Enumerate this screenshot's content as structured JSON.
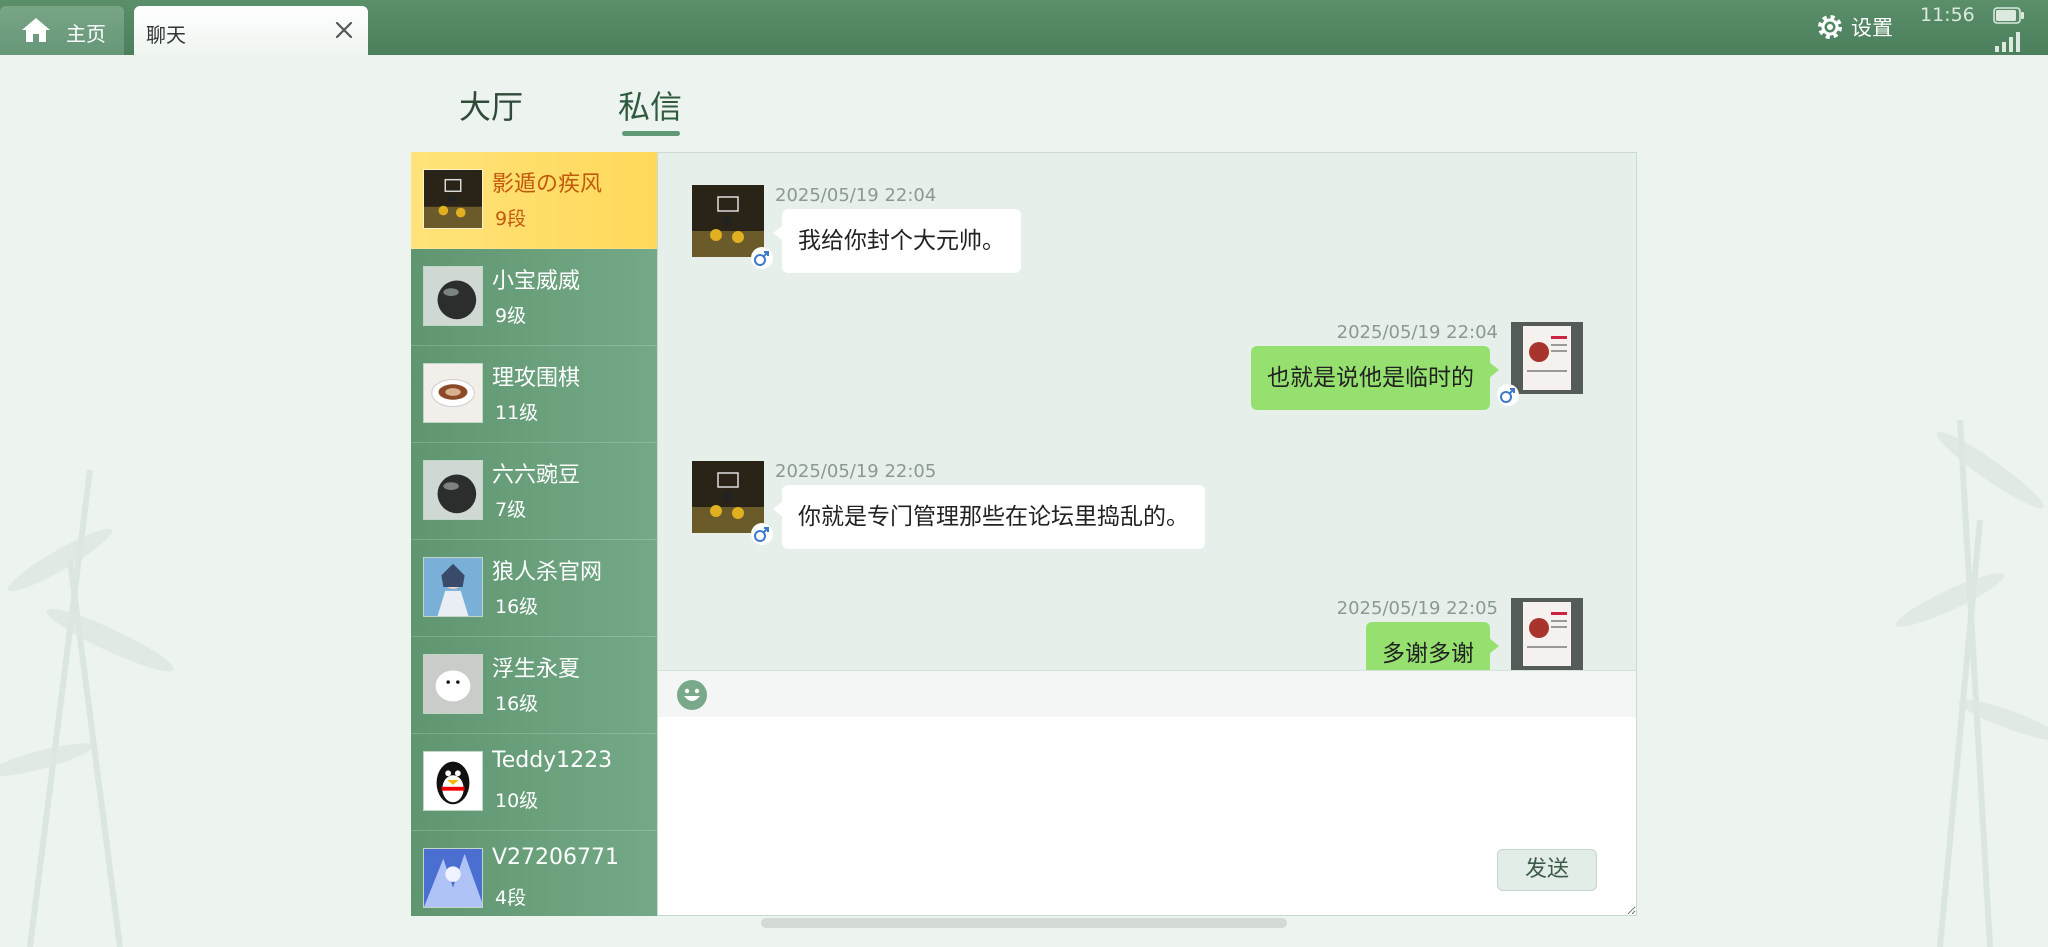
{
  "window": {
    "home_tab": "主页",
    "chat_tab": "聊天",
    "settings_label": "设置",
    "clock": "11:56"
  },
  "main_tabs": [
    {
      "label": "大厅",
      "active": false
    },
    {
      "label": "私信",
      "active": true
    }
  ],
  "contacts": [
    {
      "name": "影遁の疾风",
      "level": "9段",
      "active": true,
      "avatar": "basketball-photo"
    },
    {
      "name": "小宝威威",
      "level": "9级",
      "active": false,
      "avatar": "black-ball"
    },
    {
      "name": "理攻围棋",
      "level": "11级",
      "active": false,
      "avatar": "coffee-cup"
    },
    {
      "name": "六六豌豆",
      "level": "7级",
      "active": false,
      "avatar": "black-ball"
    },
    {
      "name": "狼人杀官网",
      "level": "16级",
      "active": false,
      "avatar": "anime-girl"
    },
    {
      "name": "浮生永夏",
      "level": "16级",
      "active": false,
      "avatar": "white-bird"
    },
    {
      "name": "Teddy1223",
      "level": "10级",
      "active": false,
      "avatar": "penguin"
    },
    {
      "name": "V27206771",
      "level": "4段",
      "active": false,
      "avatar": "anime-blue"
    }
  ],
  "messages": [
    {
      "side": "left",
      "time": "2025/05/19 22:04",
      "text": "我给你封个大元帅。",
      "avatar": "basketball-photo"
    },
    {
      "side": "right",
      "time": "2025/05/19 22:04",
      "text": "也就是说他是临时的",
      "avatar": "red-doc"
    },
    {
      "side": "left",
      "time": "2025/05/19 22:05",
      "text": "你就是专门管理那些在论坛里捣乱的。",
      "avatar": "basketball-photo"
    },
    {
      "side": "right",
      "time": "2025/05/19 22:05",
      "text": "多谢多谢",
      "avatar": "red-doc"
    }
  ],
  "composer": {
    "send_label": "发送",
    "input_value": ""
  },
  "colors": {
    "topbar": "#4c7f5c",
    "accent": "#5f9a74",
    "active_contact": "#ffd95a",
    "self_bubble": "#95e06f"
  }
}
